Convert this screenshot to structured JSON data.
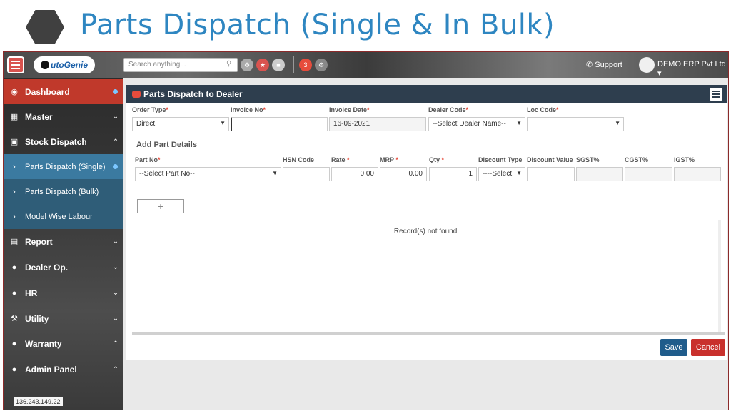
{
  "slide": {
    "title": "Parts Dispatch (Single & In Bulk)"
  },
  "topbar": {
    "logo": "utoGenie",
    "search_placeholder": "Search anything...",
    "support": "Support",
    "user": "DEMO ERP Pvt Ltd",
    "user_caret": "▾",
    "notification_count": "3"
  },
  "sidebar": {
    "items": [
      {
        "label": "Dashboard",
        "icon": "dashboard-icon"
      },
      {
        "label": "Master",
        "icon": "grid-icon"
      },
      {
        "label": "Stock Dispatch",
        "icon": "truck-icon"
      },
      {
        "label": "Parts Dispatch (Single)"
      },
      {
        "label": "Parts Dispatch (Bulk)"
      },
      {
        "label": "Model Wise Labour"
      },
      {
        "label": "Report",
        "icon": "report-icon"
      },
      {
        "label": "Dealer Op.",
        "icon": "user-icon"
      },
      {
        "label": "HR",
        "icon": "users-icon"
      },
      {
        "label": "Utility",
        "icon": "wrench-icon"
      },
      {
        "label": "Warranty",
        "icon": "chat-icon"
      },
      {
        "label": "Admin Panel",
        "icon": "admin-icon"
      }
    ],
    "ip": "136.243.149.22"
  },
  "panel": {
    "title": "Parts Dispatch to Dealer",
    "order_type_label": "Order Type",
    "order_type_value": "Direct",
    "invoice_no_label": "Invoice No",
    "invoice_no_value": "",
    "invoice_date_label": "Invoice Date",
    "invoice_date_value": "16-09-2021",
    "dealer_code_label": "Dealer Code",
    "dealer_code_value": "--Select Dealer Name--",
    "loc_code_label": "Loc Code",
    "loc_code_value": "",
    "section_title": "Add Part Details",
    "part_no_label": "Part No",
    "part_no_value": "--Select Part No--",
    "hsn_label": "HSN Code",
    "rate_label": "Rate",
    "rate_value": "0.00",
    "mrp_label": "MRP",
    "mrp_value": "0.00",
    "qty_label": "Qty",
    "qty_value": "1",
    "discount_type_label": "Discount Type",
    "discount_type_value": "----Select",
    "discount_value_label": "Discount Value",
    "sgst_label": "SGST%",
    "cgst_label": "CGST%",
    "igst_label": "IGST%",
    "add_label": "+",
    "no_records": "Record(s) not found.",
    "save": "Save",
    "cancel": "Cancel"
  }
}
